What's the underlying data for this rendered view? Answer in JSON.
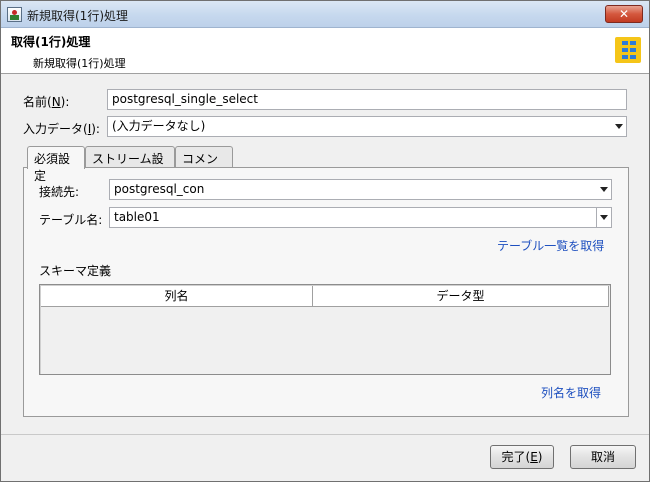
{
  "window": {
    "title": "新規取得(1行)処理",
    "close": "✕"
  },
  "header": {
    "title": "取得(1行)処理",
    "subtitle": "新規取得(1行)処理",
    "icon": "table-icon"
  },
  "form": {
    "name_label": "名前(",
    "name_key": "N",
    "name_suffix": "):",
    "name_value": "postgresql_single_select",
    "input_label": "入力データ(",
    "input_key": "I",
    "input_suffix": "):",
    "input_value": "(入力データなし)"
  },
  "tabs": [
    {
      "label": "必須設定"
    },
    {
      "label": "ストリーム設定"
    },
    {
      "label": "コメント"
    }
  ],
  "required": {
    "connection_label": "接続先:",
    "connection_value": "postgresql_con",
    "table_label": "テーブル名:",
    "table_value": "table01",
    "get_tables_link": "テーブル一覧を取得",
    "schema_label": "スキーマ定義",
    "columns": [
      "列名",
      "データ型"
    ],
    "get_columns_link": "列名を取得"
  },
  "buttons": {
    "ok_label": "完了(",
    "ok_key": "E",
    "ok_suffix": ")",
    "cancel_label": "取消"
  }
}
